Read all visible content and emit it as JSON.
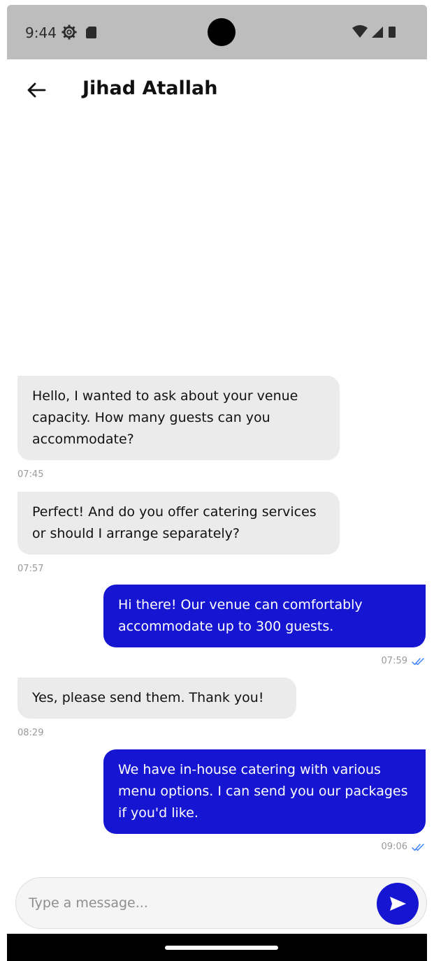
{
  "status_bar": {
    "time": "9:44",
    "icons": [
      "gear-icon",
      "sd-card-icon",
      "wifi-icon",
      "signal-icon",
      "battery-icon"
    ]
  },
  "header": {
    "title": "Jihad Atallah",
    "back_icon": "arrow-left-icon"
  },
  "colors": {
    "outgoing_bubble": "#1515d2",
    "incoming_bubble": "#ebebeb",
    "read_check": "#3b82f6"
  },
  "messages": [
    {
      "direction": "in",
      "text": "Hello, I wanted to ask about your venue capacity. How many guests can you accommodate?",
      "time": "07:45"
    },
    {
      "direction": "in",
      "text": "Perfect! And do you offer catering services or should I arrange separately?",
      "time": "07:57"
    },
    {
      "direction": "out",
      "text": "Hi there! Our venue can comfortably accommodate up to 300 guests.",
      "time": "07:59",
      "status_icon": "double-check-icon"
    },
    {
      "direction": "in",
      "text": "Yes, please send them. Thank you!",
      "time": "08:29"
    },
    {
      "direction": "out",
      "text": "We have in-house catering with various menu options. I can send you our packages if you'd like.",
      "time": "09:06",
      "status_icon": "double-check-icon"
    }
  ],
  "composer": {
    "placeholder": "Type a message...",
    "value": "",
    "send_icon": "send-icon"
  }
}
